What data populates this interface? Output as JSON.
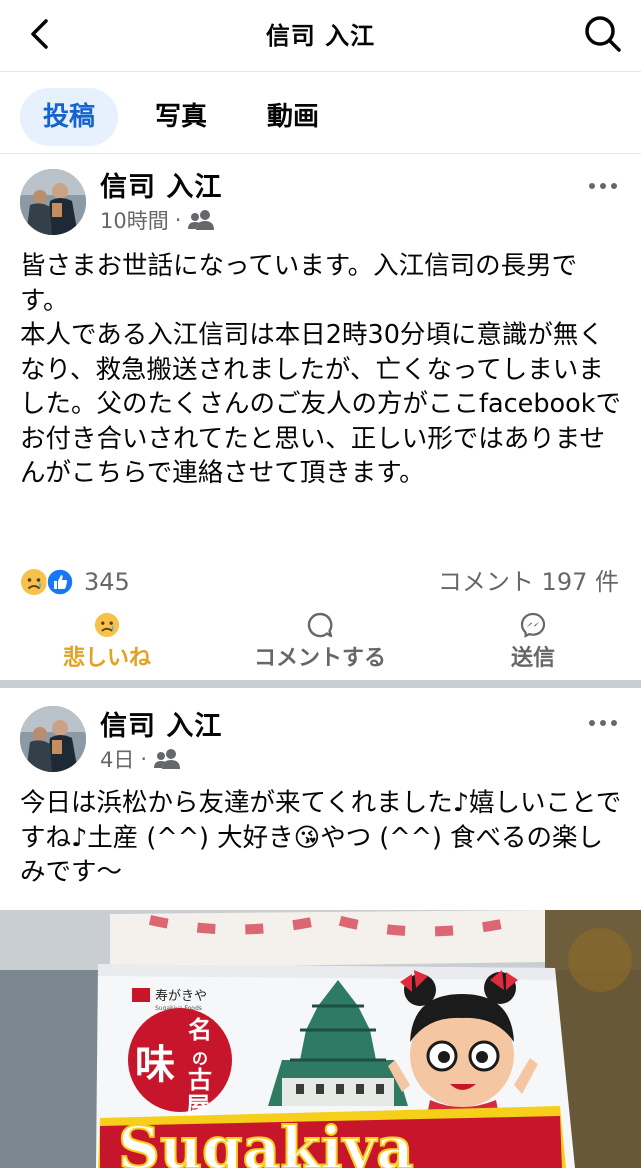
{
  "header": {
    "title": "信司 入江",
    "back_icon": "chevron-left-icon",
    "search_icon": "search-icon"
  },
  "tabs": [
    {
      "label": "投稿",
      "active": true
    },
    {
      "label": "写真",
      "active": false
    },
    {
      "label": "動画",
      "active": false
    }
  ],
  "posts": [
    {
      "author": "信司 入江",
      "time": "10時間",
      "audience_icon": "friends-icon",
      "paragraphs": [
        "皆さまお世話になっています。入江信司の長男です。",
        "本人である入江信司は本日2時30分頃に意識が無くなり、救急搬送されましたが、亡くなってしまいました。父のたくさんのご友人の方がここfacebookでお付き合いされてたと思い、正しい形ではありませんがこちらで連絡させて頂きます。"
      ],
      "reaction_count": "345",
      "comment_count": "コメント 197 件",
      "actions": {
        "sad": "悲しいね",
        "comment": "コメントする",
        "send": "送信"
      }
    },
    {
      "author": "信司 入江",
      "time": "4日",
      "audience_icon": "friends-icon",
      "paragraphs": [
        "今日は浜松から友達が来てくれました♪嬉しいことですね♪土産 (^^) 大好き😘やつ (^^) 食べるの楽しみです〜"
      ]
    }
  ],
  "photo": {
    "brand_small": "寿がきや",
    "brand_small_en": "Sugakiya Foods",
    "seal_text": "名古屋の味",
    "logo": "Sugakiya"
  },
  "colors": {
    "active_tab_bg": "#e7f0fd",
    "active_tab_text": "#1563cf",
    "sad_reaction": "#e2a224",
    "like_blue": "#1877f2"
  }
}
